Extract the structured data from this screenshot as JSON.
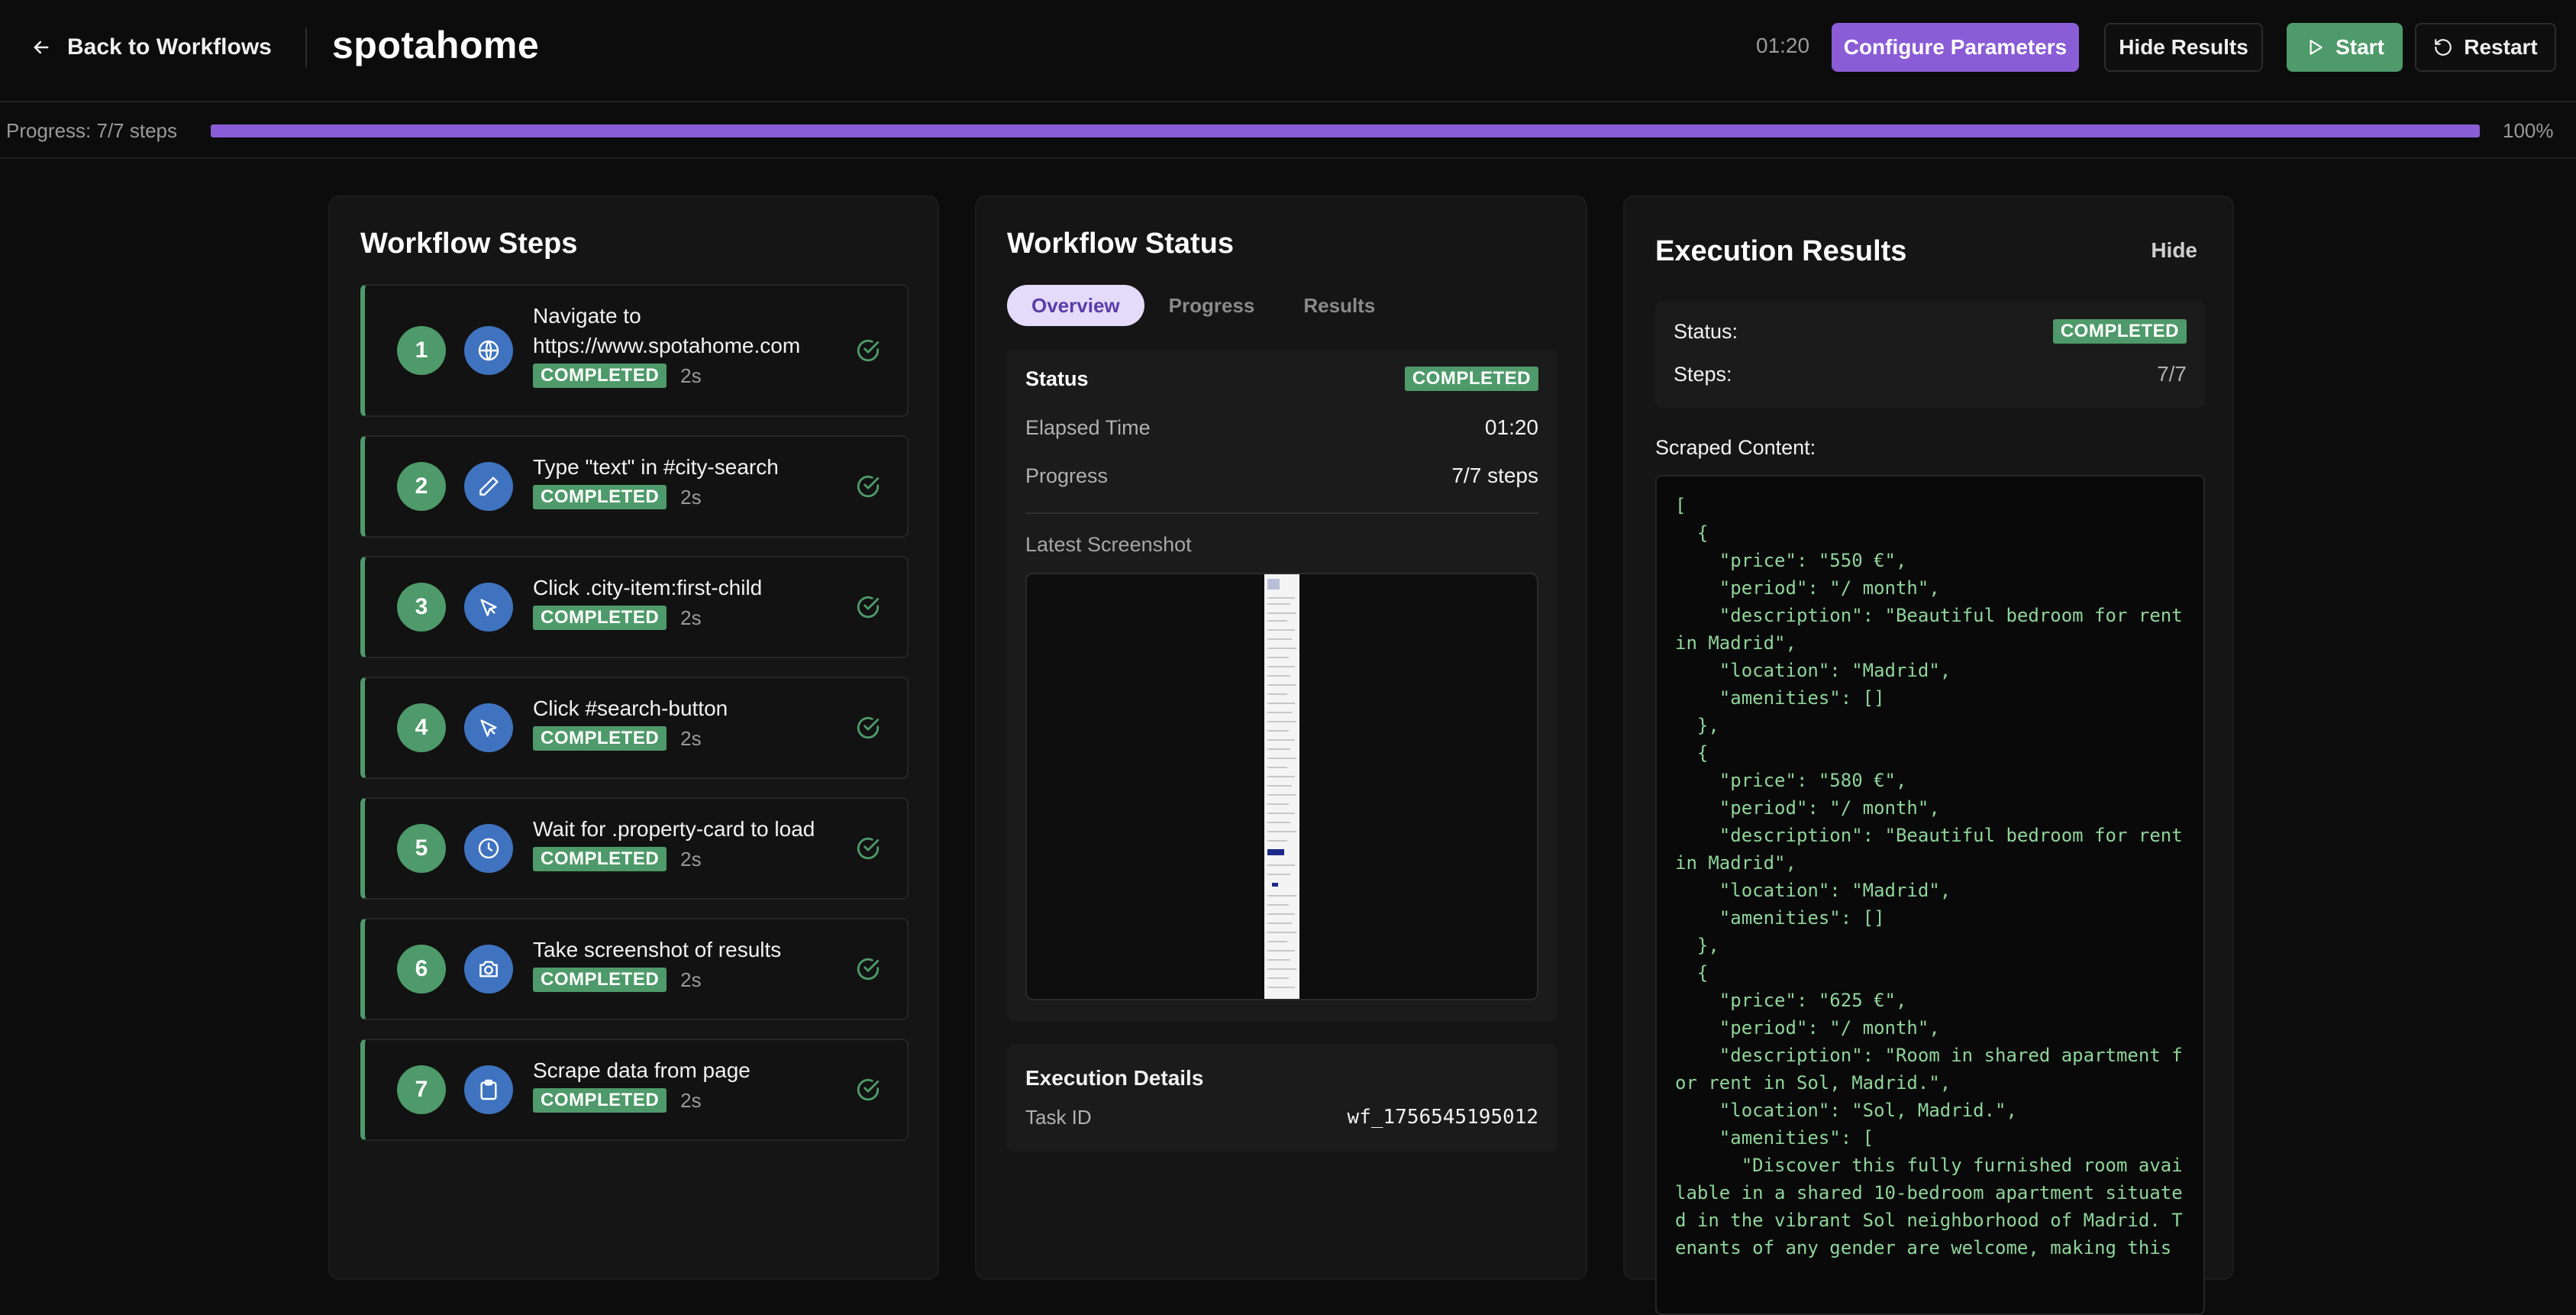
{
  "header": {
    "back_label": "Back to Workflows",
    "title": "spotahome",
    "timer": "01:20",
    "configure_label": "Configure Parameters",
    "hide_results_label": "Hide Results",
    "start_label": "Start",
    "restart_label": "Restart"
  },
  "progress": {
    "label": "Progress: 7/7 steps",
    "percent_label": "100%",
    "fraction": 1.0,
    "color": "#8a5cd6"
  },
  "steps_panel": {
    "title": "Workflow Steps",
    "steps": [
      {
        "num": "1",
        "title": "Navigate to https://www.spotahome.com",
        "status": "COMPLETED",
        "duration": "2s",
        "icon": "globe-icon"
      },
      {
        "num": "2",
        "title": "Type \"text\" in #city-search",
        "status": "COMPLETED",
        "duration": "2s",
        "icon": "pencil-icon"
      },
      {
        "num": "3",
        "title": "Click .city-item:first-child",
        "status": "COMPLETED",
        "duration": "2s",
        "icon": "cursor-icon"
      },
      {
        "num": "4",
        "title": "Click #search-button",
        "status": "COMPLETED",
        "duration": "2s",
        "icon": "cursor-icon"
      },
      {
        "num": "5",
        "title": "Wait for .property-card to load",
        "status": "COMPLETED",
        "duration": "2s",
        "icon": "clock-icon"
      },
      {
        "num": "6",
        "title": "Take screenshot of results",
        "status": "COMPLETED",
        "duration": "2s",
        "icon": "camera-icon"
      },
      {
        "num": "7",
        "title": "Scrape data from page",
        "status": "COMPLETED",
        "duration": "2s",
        "icon": "clipboard-icon"
      }
    ]
  },
  "status_panel": {
    "title": "Workflow Status",
    "tabs": [
      "Overview",
      "Progress",
      "Results"
    ],
    "active_tab": "Overview",
    "status_label": "Status",
    "status_value": "COMPLETED",
    "elapsed_label": "Elapsed Time",
    "elapsed_value": "01:20",
    "progress_label": "Progress",
    "progress_value": "7/7 steps",
    "screenshot_label": "Latest Screenshot",
    "exec_title": "Execution Details",
    "task_id_label": "Task ID",
    "task_id_value": "wf_1756545195012"
  },
  "results_panel": {
    "title": "Execution Results",
    "hide_label": "Hide",
    "status_label": "Status:",
    "status_value": "COMPLETED",
    "steps_label": "Steps:",
    "steps_value": "7/7",
    "scraped_label": "Scraped Content:",
    "scraped_text": "[\n  {\n    \"price\": \"550 €\",\n    \"period\": \"/ month\",\n    \"description\": \"Beautiful bedroom for rent in Madrid\",\n    \"location\": \"Madrid\",\n    \"amenities\": []\n  },\n  {\n    \"price\": \"580 €\",\n    \"period\": \"/ month\",\n    \"description\": \"Beautiful bedroom for rent in Madrid\",\n    \"location\": \"Madrid\",\n    \"amenities\": []\n  },\n  {\n    \"price\": \"625 €\",\n    \"period\": \"/ month\",\n    \"description\": \"Room in shared apartment for rent in Sol, Madrid.\",\n    \"location\": \"Sol, Madrid.\",\n    \"amenities\": [\n      \"Discover this fully furnished room available in a shared 10-bedroom apartment situated in the vibrant Sol neighborhood of Madrid. Tenants of any gender are welcome, making this"
  },
  "colors": {
    "accent": "#8a5cd6",
    "success": "#4e9a6a",
    "icon_blue": "#3f73c0"
  }
}
